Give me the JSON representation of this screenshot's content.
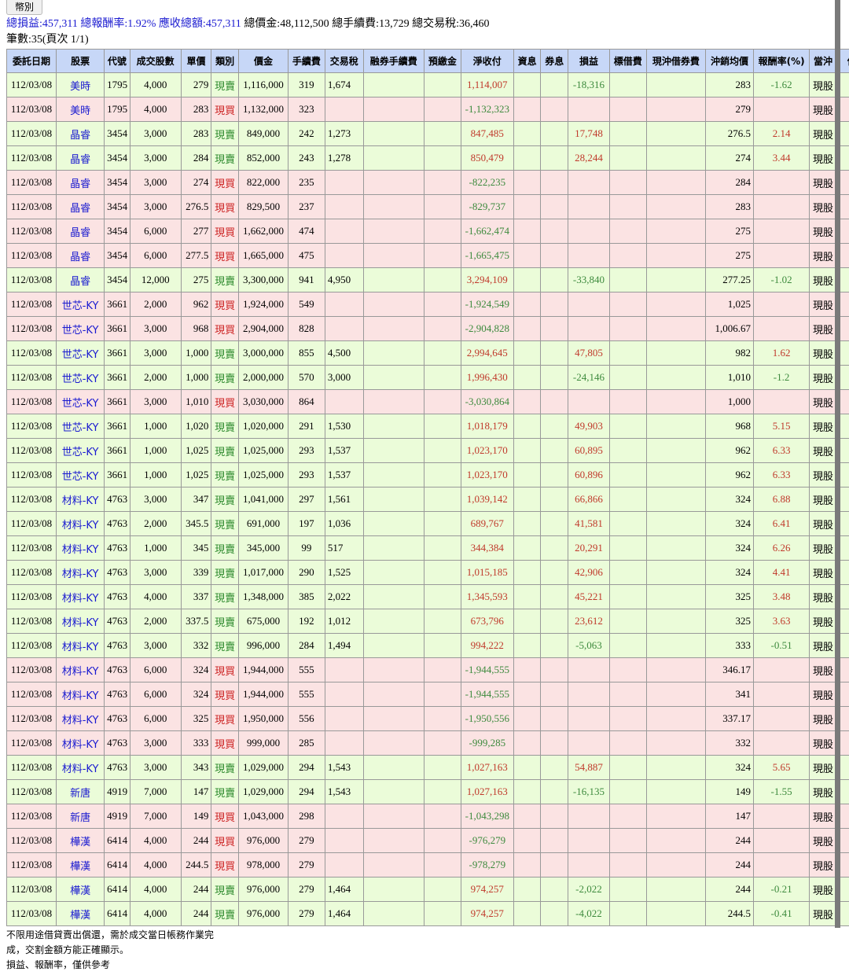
{
  "currency_button": "幣別",
  "summary": {
    "pnl": "總損益:457,311",
    "rate": "總報酬率:1.92%",
    "receivable": "應收總額:457,311",
    "amount": "總價金:48,112,500",
    "fee": "總手續費:13,729",
    "tax": "總交易稅:36,460"
  },
  "count": "筆數:35(頁次 1/1)",
  "headers": [
    "委託日期",
    "股票",
    "代號",
    "成交股數",
    "單價",
    "類別",
    "價金",
    "手續費",
    "交易稅",
    "融券手續費",
    "預繳金",
    "淨收付",
    "資息",
    "券息",
    "損益",
    "標借費",
    "現沖借券費",
    "沖銷均價",
    "報酬率(%)",
    "當沖",
    "借貸還"
  ],
  "rows": [
    [
      "112/03/08",
      "美時",
      "1795",
      "4,000",
      "279",
      "現賣",
      "1,116,000",
      "319",
      "1,674",
      "1,114,007",
      "-18,316",
      "283",
      "-1.62"
    ],
    [
      "112/03/08",
      "美時",
      "1795",
      "4,000",
      "283",
      "現買",
      "1,132,000",
      "323",
      "",
      "-1,132,323",
      "",
      "279",
      ""
    ],
    [
      "112/03/08",
      "晶睿",
      "3454",
      "3,000",
      "283",
      "現賣",
      "849,000",
      "242",
      "1,273",
      "847,485",
      "17,748",
      "276.5",
      "2.14"
    ],
    [
      "112/03/08",
      "晶睿",
      "3454",
      "3,000",
      "284",
      "現賣",
      "852,000",
      "243",
      "1,278",
      "850,479",
      "28,244",
      "274",
      "3.44"
    ],
    [
      "112/03/08",
      "晶睿",
      "3454",
      "3,000",
      "274",
      "現買",
      "822,000",
      "235",
      "",
      "-822,235",
      "",
      "284",
      ""
    ],
    [
      "112/03/08",
      "晶睿",
      "3454",
      "3,000",
      "276.5",
      "現買",
      "829,500",
      "237",
      "",
      "-829,737",
      "",
      "283",
      ""
    ],
    [
      "112/03/08",
      "晶睿",
      "3454",
      "6,000",
      "277",
      "現買",
      "1,662,000",
      "474",
      "",
      "-1,662,474",
      "",
      "275",
      ""
    ],
    [
      "112/03/08",
      "晶睿",
      "3454",
      "6,000",
      "277.5",
      "現買",
      "1,665,000",
      "475",
      "",
      "-1,665,475",
      "",
      "275",
      ""
    ],
    [
      "112/03/08",
      "晶睿",
      "3454",
      "12,000",
      "275",
      "現賣",
      "3,300,000",
      "941",
      "4,950",
      "3,294,109",
      "-33,840",
      "277.25",
      "-1.02"
    ],
    [
      "112/03/08",
      "世芯-KY",
      "3661",
      "2,000",
      "962",
      "現買",
      "1,924,000",
      "549",
      "",
      "-1,924,549",
      "",
      "1,025",
      ""
    ],
    [
      "112/03/08",
      "世芯-KY",
      "3661",
      "3,000",
      "968",
      "現買",
      "2,904,000",
      "828",
      "",
      "-2,904,828",
      "",
      "1,006.67",
      ""
    ],
    [
      "112/03/08",
      "世芯-KY",
      "3661",
      "3,000",
      "1,000",
      "現賣",
      "3,000,000",
      "855",
      "4,500",
      "2,994,645",
      "47,805",
      "982",
      "1.62"
    ],
    [
      "112/03/08",
      "世芯-KY",
      "3661",
      "2,000",
      "1,000",
      "現賣",
      "2,000,000",
      "570",
      "3,000",
      "1,996,430",
      "-24,146",
      "1,010",
      "-1.2"
    ],
    [
      "112/03/08",
      "世芯-KY",
      "3661",
      "3,000",
      "1,010",
      "現買",
      "3,030,000",
      "864",
      "",
      "-3,030,864",
      "",
      "1,000",
      ""
    ],
    [
      "112/03/08",
      "世芯-KY",
      "3661",
      "1,000",
      "1,020",
      "現賣",
      "1,020,000",
      "291",
      "1,530",
      "1,018,179",
      "49,903",
      "968",
      "5.15"
    ],
    [
      "112/03/08",
      "世芯-KY",
      "3661",
      "1,000",
      "1,025",
      "現賣",
      "1,025,000",
      "293",
      "1,537",
      "1,023,170",
      "60,895",
      "962",
      "6.33"
    ],
    [
      "112/03/08",
      "世芯-KY",
      "3661",
      "1,000",
      "1,025",
      "現賣",
      "1,025,000",
      "293",
      "1,537",
      "1,023,170",
      "60,896",
      "962",
      "6.33"
    ],
    [
      "112/03/08",
      "材料-KY",
      "4763",
      "3,000",
      "347",
      "現賣",
      "1,041,000",
      "297",
      "1,561",
      "1,039,142",
      "66,866",
      "324",
      "6.88"
    ],
    [
      "112/03/08",
      "材料-KY",
      "4763",
      "2,000",
      "345.5",
      "現賣",
      "691,000",
      "197",
      "1,036",
      "689,767",
      "41,581",
      "324",
      "6.41"
    ],
    [
      "112/03/08",
      "材料-KY",
      "4763",
      "1,000",
      "345",
      "現賣",
      "345,000",
      "99",
      "517",
      "344,384",
      "20,291",
      "324",
      "6.26"
    ],
    [
      "112/03/08",
      "材料-KY",
      "4763",
      "3,000",
      "339",
      "現賣",
      "1,017,000",
      "290",
      "1,525",
      "1,015,185",
      "42,906",
      "324",
      "4.41"
    ],
    [
      "112/03/08",
      "材料-KY",
      "4763",
      "4,000",
      "337",
      "現賣",
      "1,348,000",
      "385",
      "2,022",
      "1,345,593",
      "45,221",
      "325",
      "3.48"
    ],
    [
      "112/03/08",
      "材料-KY",
      "4763",
      "2,000",
      "337.5",
      "現賣",
      "675,000",
      "192",
      "1,012",
      "673,796",
      "23,612",
      "325",
      "3.63"
    ],
    [
      "112/03/08",
      "材料-KY",
      "4763",
      "3,000",
      "332",
      "現賣",
      "996,000",
      "284",
      "1,494",
      "994,222",
      "-5,063",
      "333",
      "-0.51"
    ],
    [
      "112/03/08",
      "材料-KY",
      "4763",
      "6,000",
      "324",
      "現買",
      "1,944,000",
      "555",
      "",
      "-1,944,555",
      "",
      "346.17",
      ""
    ],
    [
      "112/03/08",
      "材料-KY",
      "4763",
      "6,000",
      "324",
      "現買",
      "1,944,000",
      "555",
      "",
      "-1,944,555",
      "",
      "341",
      ""
    ],
    [
      "112/03/08",
      "材料-KY",
      "4763",
      "6,000",
      "325",
      "現買",
      "1,950,000",
      "556",
      "",
      "-1,950,556",
      "",
      "337.17",
      ""
    ],
    [
      "112/03/08",
      "材料-KY",
      "4763",
      "3,000",
      "333",
      "現買",
      "999,000",
      "285",
      "",
      "-999,285",
      "",
      "332",
      ""
    ],
    [
      "112/03/08",
      "材料-KY",
      "4763",
      "3,000",
      "343",
      "現賣",
      "1,029,000",
      "294",
      "1,543",
      "1,027,163",
      "54,887",
      "324",
      "5.65"
    ],
    [
      "112/03/08",
      "新唐",
      "4919",
      "7,000",
      "147",
      "現賣",
      "1,029,000",
      "294",
      "1,543",
      "1,027,163",
      "-16,135",
      "149",
      "-1.55"
    ],
    [
      "112/03/08",
      "新唐",
      "4919",
      "7,000",
      "149",
      "現買",
      "1,043,000",
      "298",
      "",
      "-1,043,298",
      "",
      "147",
      ""
    ],
    [
      "112/03/08",
      "樺漢",
      "6414",
      "4,000",
      "244",
      "現買",
      "976,000",
      "279",
      "",
      "-976,279",
      "",
      "244",
      ""
    ],
    [
      "112/03/08",
      "樺漢",
      "6414",
      "4,000",
      "244.5",
      "現買",
      "978,000",
      "279",
      "",
      "-978,279",
      "",
      "244",
      ""
    ],
    [
      "112/03/08",
      "樺漢",
      "6414",
      "4,000",
      "244",
      "現賣",
      "976,000",
      "279",
      "1,464",
      "974,257",
      "-2,022",
      "244",
      "-0.21"
    ],
    [
      "112/03/08",
      "樺漢",
      "6414",
      "4,000",
      "244",
      "現賣",
      "976,000",
      "279",
      "1,464",
      "974,257",
      "-4,022",
      "244.5",
      "-0.41"
    ]
  ],
  "stock_type": "現股",
  "footer": [
    "不限用途借貸賣出償還，需於成交當日帳務作業完",
    "成，交割金額方能正確顯示。",
    "損益、報酬率，僅供參考"
  ]
}
